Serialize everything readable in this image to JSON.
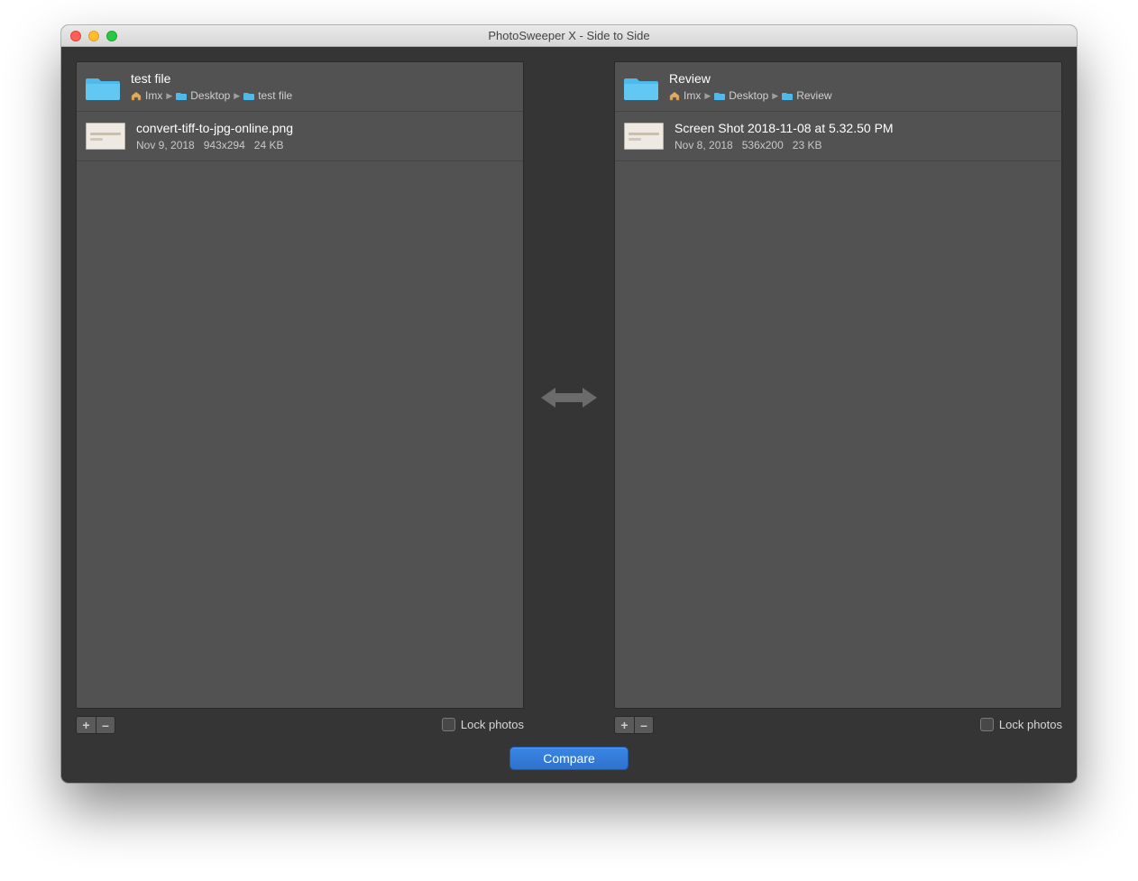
{
  "window": {
    "title": "PhotoSweeper X - Side to Side"
  },
  "left": {
    "folder": {
      "name": "test file"
    },
    "breadcrumb": [
      {
        "kind": "home",
        "label": "Imx"
      },
      {
        "kind": "folder",
        "label": "Desktop"
      },
      {
        "kind": "folder",
        "label": "test file"
      }
    ],
    "file": {
      "name": "convert-tiff-to-jpg-online.png",
      "date": "Nov 9, 2018",
      "dimensions": "943x294",
      "size": "24 KB"
    },
    "lock_label": "Lock photos"
  },
  "right": {
    "folder": {
      "name": "Review"
    },
    "breadcrumb": [
      {
        "kind": "home",
        "label": "Imx"
      },
      {
        "kind": "folder",
        "label": "Desktop"
      },
      {
        "kind": "folder",
        "label": "Review"
      }
    ],
    "file": {
      "name": "Screen Shot 2018-11-08 at 5.32.50 PM",
      "date": "Nov 8, 2018",
      "dimensions": "536x200",
      "size": "23 KB"
    },
    "lock_label": "Lock photos"
  },
  "footer": {
    "compare_label": "Compare"
  },
  "glyphs": {
    "plus": "+",
    "minus": "–"
  }
}
